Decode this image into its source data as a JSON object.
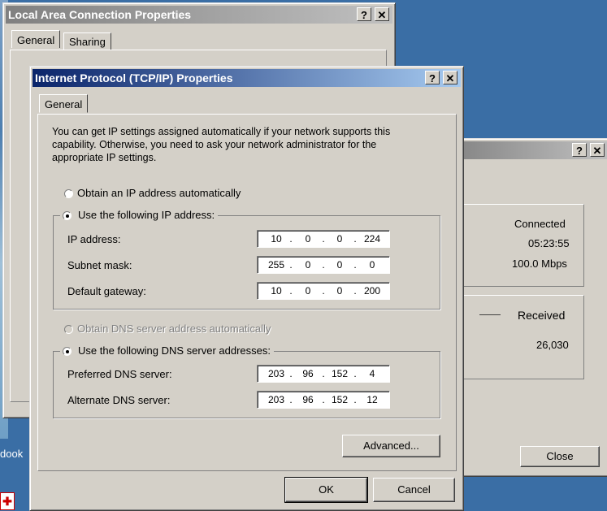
{
  "desktop": {
    "partial_text": "dook"
  },
  "lan_window": {
    "title": "Local Area Connection Properties",
    "tabs": [
      "General",
      "Sharing"
    ]
  },
  "status_window": {
    "status": "Connected",
    "duration": "05:23:55",
    "speed": "100.0 Mbps",
    "received_label": "Received",
    "received_value": "26,030",
    "close_label": "Close"
  },
  "tcpip_window": {
    "title": "Internet Protocol (TCP/IP) Properties",
    "tab": "General",
    "intro_lines": [
      "You can get IP settings assigned automatically if your network supports this",
      "capability. Otherwise, you need to ask your network administrator for the",
      "appropriate IP settings."
    ],
    "obtain_ip_label": "Obtain an IP address automatically",
    "use_ip_label": "Use the following IP address:",
    "ip_selection": "manual",
    "ip_fields": [
      {
        "label": "IP address:",
        "octets": [
          "10",
          "0",
          "0",
          "224"
        ]
      },
      {
        "label": "Subnet mask:",
        "octets": [
          "255",
          "0",
          "0",
          "0"
        ]
      },
      {
        "label": "Default gateway:",
        "octets": [
          "10",
          "0",
          "0",
          "200"
        ]
      }
    ],
    "obtain_dns_label": "Obtain DNS server address automatically",
    "use_dns_label": "Use the following DNS server addresses:",
    "dns_selection": "manual",
    "dns_fields": [
      {
        "label": "Preferred DNS server:",
        "octets": [
          "203",
          "96",
          "152",
          "4"
        ]
      },
      {
        "label": "Alternate DNS server:",
        "octets": [
          "203",
          "96",
          "152",
          "12"
        ]
      }
    ],
    "advanced_label": "Advanced...",
    "ok_label": "OK",
    "cancel_label": "Cancel"
  },
  "titlebar_buttons": {
    "help": "?",
    "close": "✕"
  }
}
